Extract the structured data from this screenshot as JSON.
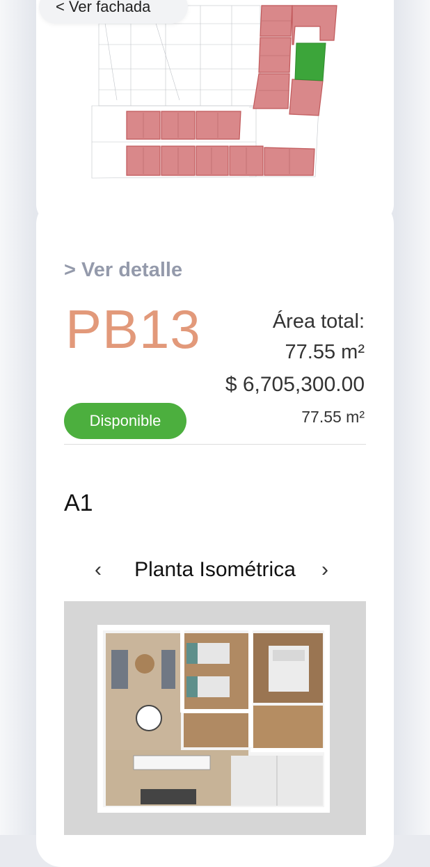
{
  "back_link": "< Ver fachada",
  "detail_link": "> Ver detalle",
  "unit": {
    "code": "PB13",
    "area_label": "Área total:",
    "area_value": "77.55 m²",
    "price": "$ 6,705,300.00",
    "area_secondary": "77.55 m²",
    "status": "Disponible",
    "model": "A1"
  },
  "carousel": {
    "title": "Planta Isométrica",
    "prev": "‹",
    "next": "›"
  },
  "colors": {
    "accent": "#e2997a",
    "available": "#4caf3e",
    "unit_red": "#d9888a",
    "selected_green": "#3ca53a"
  }
}
